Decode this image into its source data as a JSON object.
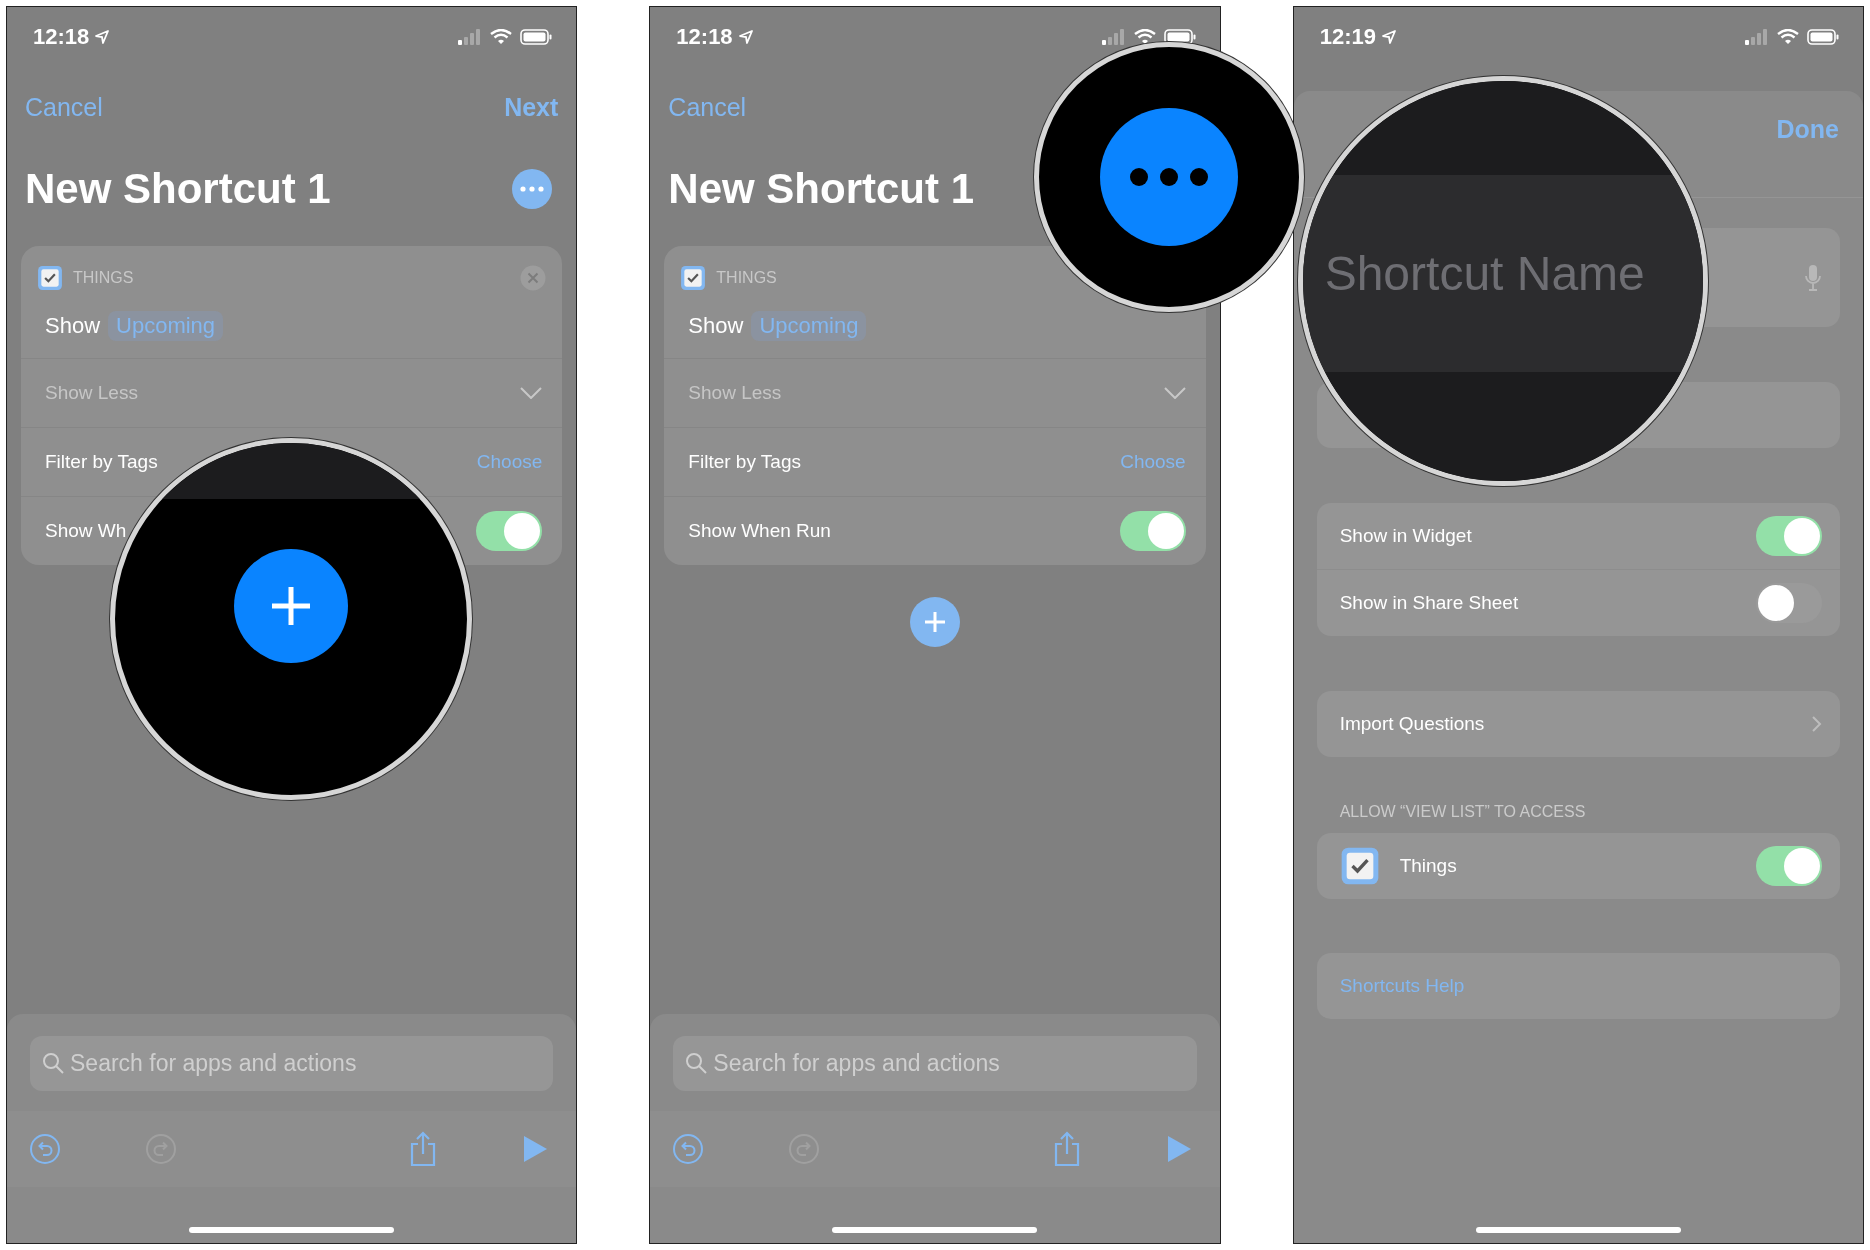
{
  "panels": [
    {
      "kind": "editor",
      "time": "12:18",
      "cancel": "Cancel",
      "next": "Next",
      "title": "New Shortcut 1",
      "more_button": true,
      "action": {
        "app_label": "THINGS",
        "checked": true,
        "show_label": "Show",
        "show_value": "Upcoming",
        "show_less": "Show Less",
        "filter_label": "Filter by Tags",
        "filter_value": "Choose",
        "toggle_label": "Show Wh",
        "toggle_on": true
      },
      "search": {
        "placeholder": "Search for apps and actions"
      },
      "toolbar": [
        {
          "kind": "undo",
          "disabled": false
        },
        {
          "kind": "redo",
          "disabled": true
        },
        {
          "kind": "share",
          "disabled": false
        },
        {
          "kind": "play",
          "disabled": false
        }
      ],
      "magnifier": {
        "kind": "add"
      }
    },
    {
      "kind": "editor",
      "time": "12:18",
      "cancel": "Cancel",
      "title": "New Shortcut 1",
      "action": {
        "app_label": "THINGS",
        "checked": true,
        "show_label": "Show",
        "show_value": "Upcoming",
        "show_less": "Show Less",
        "filter_label": "Filter by Tags",
        "filter_value": "Choose",
        "toggle_label": "Show When Run",
        "toggle_on": true
      },
      "add_button": true,
      "search": {
        "placeholder": "Search for apps and actions"
      },
      "toolbar": [
        {
          "kind": "undo",
          "disabled": false
        },
        {
          "kind": "redo",
          "disabled": true
        },
        {
          "kind": "share",
          "disabled": false
        },
        {
          "kind": "play",
          "disabled": false
        }
      ],
      "magnifier": {
        "kind": "more"
      }
    },
    {
      "kind": "settings",
      "time": "12:19",
      "done": "Done",
      "toggles": [
        {
          "label": "Show in Widget",
          "on": true
        },
        {
          "label": "Show in Share Sheet",
          "on": false
        }
      ],
      "import_label": "Import Questions",
      "section_header": "ALLOW “VIEW LIST” TO ACCESS",
      "access": {
        "label": "Things",
        "checked": true,
        "on": true
      },
      "help_link": "Shortcuts Help",
      "magnifier": {
        "kind": "name_field",
        "placeholder": "Shortcut Name"
      }
    }
  ]
}
